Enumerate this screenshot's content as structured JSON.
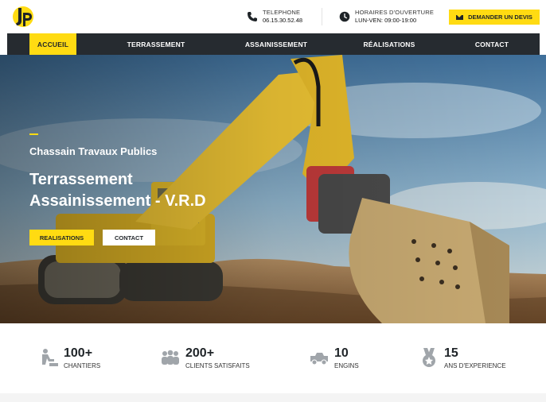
{
  "header": {
    "phone_label": "TELEPHONE",
    "phone_value": "06.15.30.52.48",
    "hours_label": "HORAIRES D'OUVERTURE",
    "hours_value": "LUN-VEN: 09:00-19:00",
    "quote_button": "DEMANDER UN DEVIS"
  },
  "nav": {
    "items": [
      {
        "label": "ACCUEIL",
        "active": true
      },
      {
        "label": "TERRASSEMENT",
        "active": false
      },
      {
        "label": "ASSAINISSEMENT",
        "active": false
      },
      {
        "label": "RÉALISATIONS",
        "active": false
      },
      {
        "label": "CONTACT",
        "active": false
      }
    ]
  },
  "hero": {
    "subtitle": "Chassain Travaux Publics",
    "title_line1": "Terrassement",
    "title_line2": "Assainissement - V.R.D",
    "btn_realisations": "REALISATIONS",
    "btn_contact": "CONTACT"
  },
  "stats": [
    {
      "number": "100+",
      "label": "CHANTIERS",
      "icon": "worker-shovel-icon"
    },
    {
      "number": "200+",
      "label": "CLIENTS SATISFAITS",
      "icon": "people-group-icon"
    },
    {
      "number": "10",
      "label": "ENGINS",
      "icon": "truck-icon"
    },
    {
      "number": "15",
      "label": "ANS D'EXPERIENCE",
      "icon": "medal-icon"
    }
  ],
  "colors": {
    "accent": "#ffdb12",
    "nav_bg": "#262b30",
    "text_dark": "#1f2428"
  }
}
